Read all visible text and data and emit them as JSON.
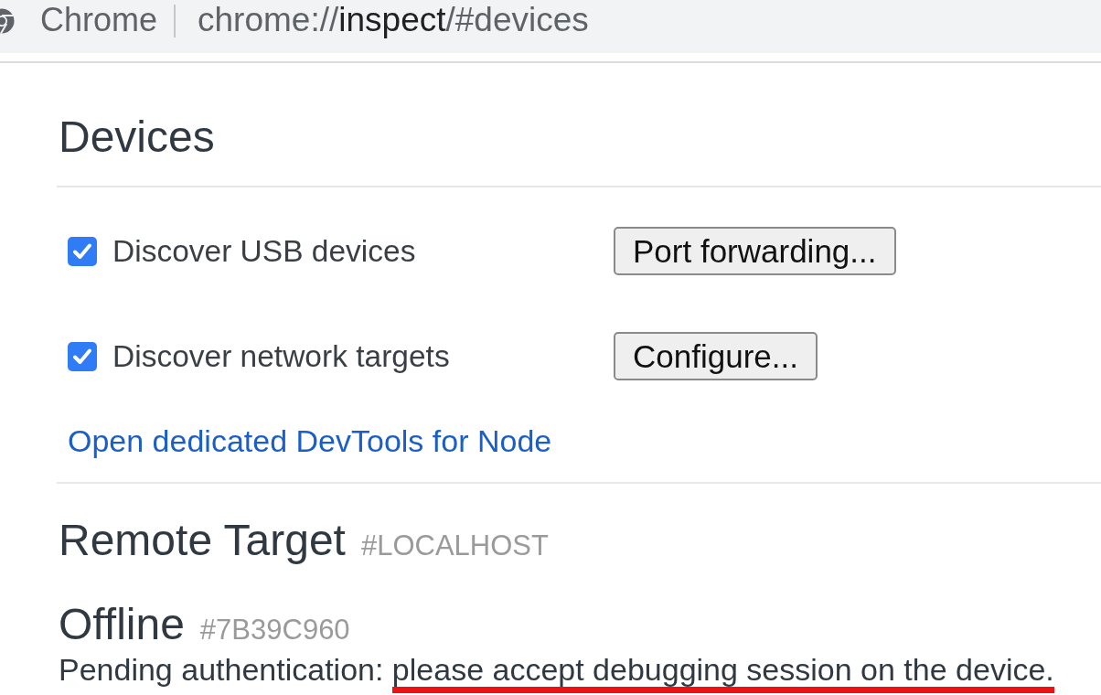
{
  "address_bar": {
    "site_label": "Chrome",
    "url": {
      "scheme": "chrome://",
      "host": "inspect",
      "path": "/#devices"
    }
  },
  "devices_section": {
    "title": "Devices",
    "options": [
      {
        "label": "Discover USB devices",
        "checked": true,
        "button": "Port forwarding..."
      },
      {
        "label": "Discover network targets",
        "checked": true,
        "button": "Configure..."
      }
    ],
    "node_link": "Open dedicated DevTools for Node"
  },
  "remote_target": {
    "title": "Remote Target",
    "tag": "#LOCALHOST"
  },
  "devices": [
    {
      "name": "Offline",
      "id": "#7B39C960",
      "status": [
        {
          "text": "Pending authentication:",
          "underlined": false
        },
        {
          "text": "please accept debugging session on the device.",
          "underlined": true
        }
      ]
    }
  ]
}
